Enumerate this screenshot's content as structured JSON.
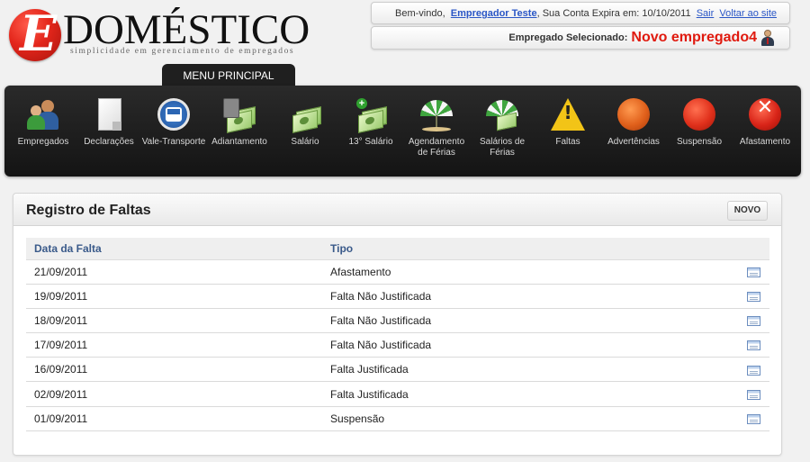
{
  "brand": {
    "logo_letter": "E",
    "name": "DOMÉSTICO",
    "tagline": "simplicidade em gerenciamento de empregados"
  },
  "account": {
    "welcome": "Bem-vindo,",
    "user": "Empregador Teste",
    "expires_text": ", Sua Conta Expira em: 10/10/2011",
    "logout": "Sair",
    "back_to_site": "Voltar ao site",
    "selected_label": "Empregado Selecionado:",
    "selected_name": "Novo empregado4"
  },
  "menu": {
    "title": "MENU PRINCIPAL",
    "items": [
      {
        "label": "Empregados",
        "icon": "employees-icon"
      },
      {
        "label": "Declarações",
        "icon": "document-icon"
      },
      {
        "label": "Vale-Transporte",
        "icon": "bus-icon"
      },
      {
        "label": "Adiantamento",
        "icon": "calculator-money-icon"
      },
      {
        "label": "Salário",
        "icon": "money-icon"
      },
      {
        "label": "13° Salário",
        "icon": "money-plus-icon"
      },
      {
        "label": "Agendamento de Férias",
        "icon": "umbrella-icon"
      },
      {
        "label": "Salários de Férias",
        "icon": "umbrella-money-icon"
      },
      {
        "label": "Faltas",
        "icon": "warning-icon"
      },
      {
        "label": "Advertências",
        "icon": "orange-ball-icon"
      },
      {
        "label": "Suspensão",
        "icon": "red-ball-icon"
      },
      {
        "label": "Afastamento",
        "icon": "close-circle-icon"
      }
    ]
  },
  "panel": {
    "title": "Registro de Faltas",
    "new_button": "NOVO",
    "columns": [
      "Data da Falta",
      "Tipo"
    ],
    "rows": [
      {
        "date": "21/09/2011",
        "type": "Afastamento"
      },
      {
        "date": "19/09/2011",
        "type": "Falta Não Justificada"
      },
      {
        "date": "18/09/2011",
        "type": "Falta Não Justificada"
      },
      {
        "date": "17/09/2011",
        "type": "Falta Não Justificada"
      },
      {
        "date": "16/09/2011",
        "type": "Falta Justificada"
      },
      {
        "date": "02/09/2011",
        "type": "Falta Justificada"
      },
      {
        "date": "01/09/2011",
        "type": "Suspensão"
      }
    ]
  },
  "colors": {
    "accent_red": "#e01a0f",
    "link_blue": "#2a56c6",
    "menu_bg": "#1f1f1f",
    "header_blue": "#3a5a8a"
  }
}
